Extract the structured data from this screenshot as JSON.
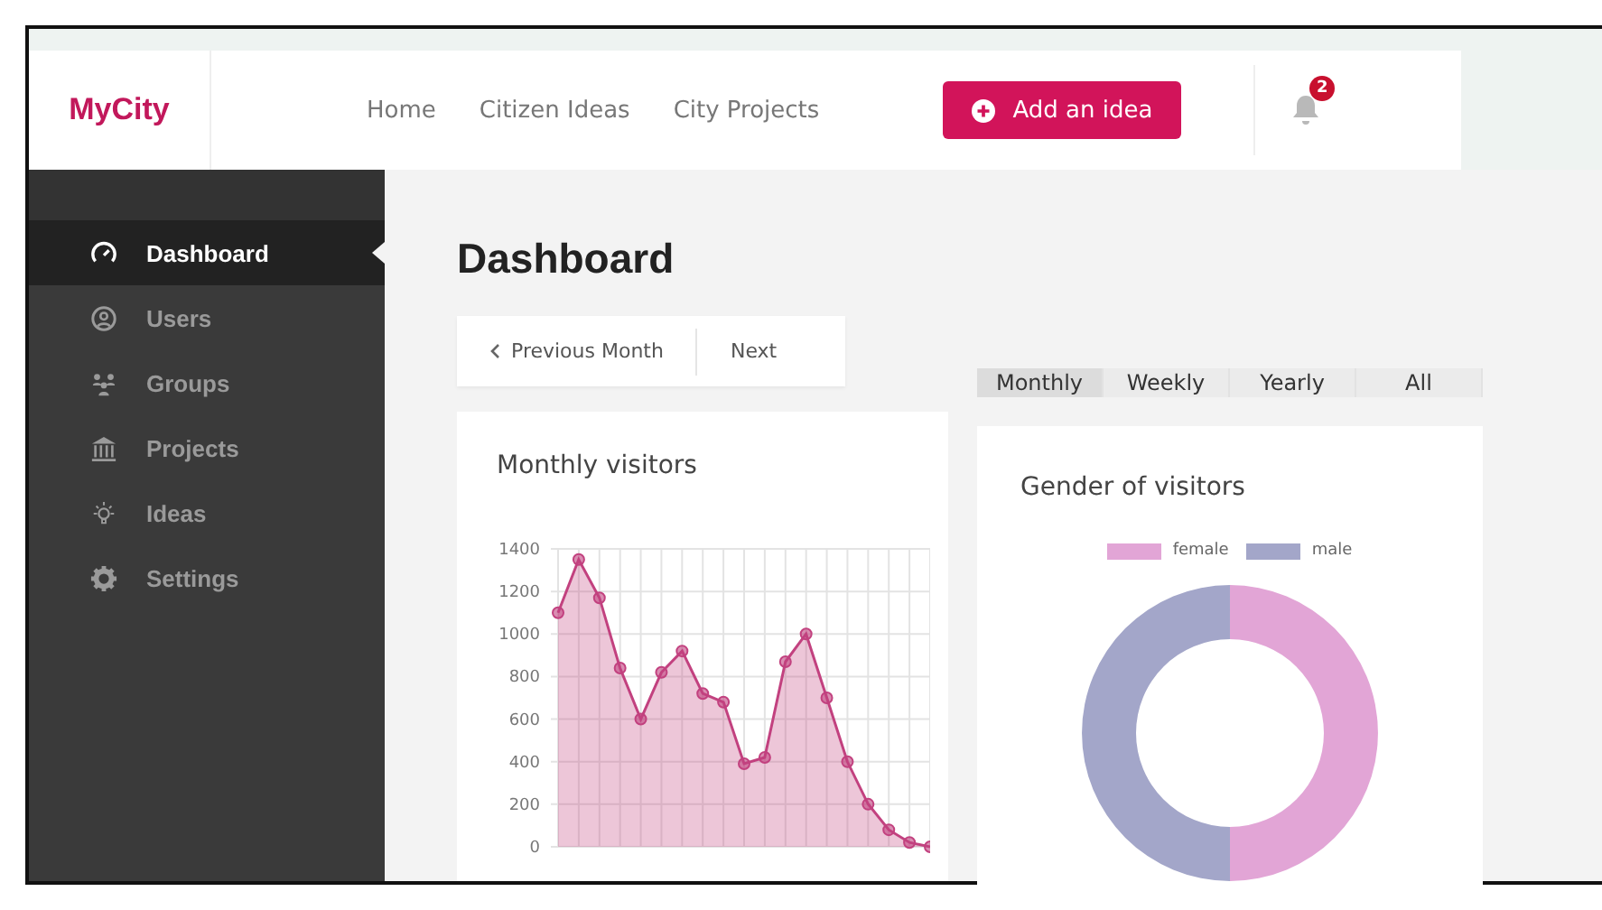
{
  "header": {
    "logo": "MyCity",
    "nav": [
      {
        "label": "Home"
      },
      {
        "label": "Citizen Ideas"
      },
      {
        "label": "City Projects"
      }
    ],
    "add_button": "Add an idea",
    "notifications_badge": "2"
  },
  "sidebar": {
    "items": [
      {
        "label": "Dashboard",
        "selected": true
      },
      {
        "label": "Users",
        "selected": false
      },
      {
        "label": "Groups",
        "selected": false
      },
      {
        "label": "Projects",
        "selected": false
      },
      {
        "label": "Ideas",
        "selected": false
      },
      {
        "label": "Settings",
        "selected": false
      }
    ]
  },
  "page_title": "Dashboard",
  "month_nav": {
    "previous": "Previous Month",
    "next": "Next"
  },
  "period_tabs": [
    {
      "label": "Monthly",
      "selected": true
    },
    {
      "label": "Weekly",
      "selected": false
    },
    {
      "label": "Yearly",
      "selected": false
    },
    {
      "label": "All",
      "selected": false
    }
  ],
  "visitors_card": {
    "title": "Monthly visitors",
    "chart_data": {
      "type": "area",
      "grid": true,
      "ylim": [
        0,
        1400
      ],
      "yticks": [
        0,
        200,
        400,
        600,
        800,
        1000,
        1200,
        1400
      ],
      "series": [
        {
          "color": "#c2417f",
          "values": [
            1100,
            1350,
            1170,
            840,
            600,
            820,
            920,
            720,
            680,
            390,
            420,
            870,
            1000,
            700,
            400,
            200,
            80,
            20,
            0
          ]
        }
      ]
    }
  },
  "gender_card": {
    "title": "Gender of visitors",
    "chart_data": {
      "type": "donut",
      "legend": true,
      "categories": [
        "female",
        "male"
      ],
      "values": [
        50,
        50
      ],
      "colors": [
        "#e2a5d6",
        "#a3a6c9"
      ]
    }
  }
}
